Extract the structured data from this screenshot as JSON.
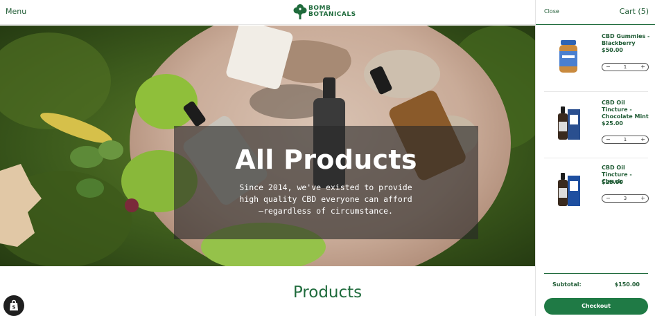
{
  "header": {
    "menu_label": "Menu",
    "logo_line1": "BOMB",
    "logo_line2": "BOTANICALS"
  },
  "hero": {
    "title": "All Products",
    "subtitle_line1": "Since 2014, we've existed to provide",
    "subtitle_line2": "high quality CBD everyone can afford",
    "subtitle_line3": "—regardless of circumstance."
  },
  "section": {
    "products_title": "Products"
  },
  "cart": {
    "close_label": "Close",
    "title": "Cart (5)",
    "items": [
      {
        "name": "CBD Gummies - Blackberry",
        "price": "$50.00",
        "quantity": "1",
        "image_icon": "gummies-jar-icon"
      },
      {
        "name": "CBD Oil Tincture - Chocolate Mint",
        "price": "$25.00",
        "quantity": "1",
        "image_icon": "tincture-bottle-icon"
      },
      {
        "name": "CBD Oil Tincture - Classic",
        "price": "$25.00",
        "quantity": "3",
        "image_icon": "tincture-bottle-icon"
      }
    ],
    "subtotal_label": "Subtotal:",
    "subtotal_value": "$150.00",
    "checkout_label": "Checkout"
  },
  "colors": {
    "brand_green": "#1f6b3c",
    "checkout_green": "#1f7a45",
    "overlay": "rgba(40,40,40,0.62)"
  }
}
